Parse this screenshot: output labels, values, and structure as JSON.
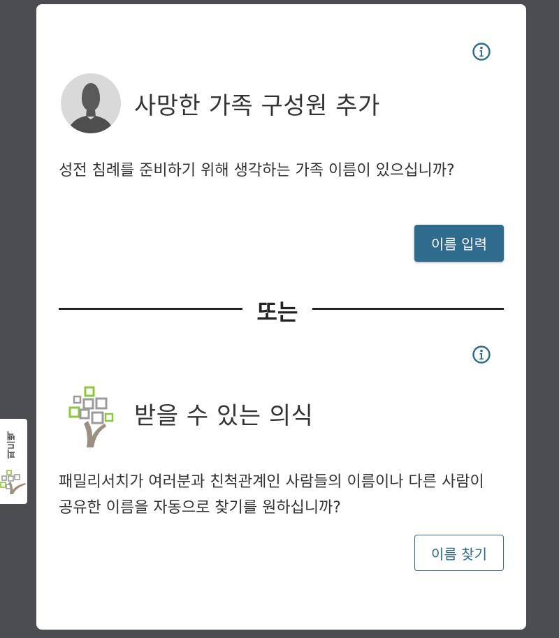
{
  "section_add": {
    "title": "사망한 가족 구성원 추가",
    "description": "성전 침례를 준비하기 위해 생각하는 가족 이름이 있으십니까?",
    "button_label": "이름 입력",
    "info_icon": "info-icon",
    "avatar_icon": "person-silhouette-icon"
  },
  "divider": {
    "label": "또는"
  },
  "section_ordinances": {
    "title": "받을 수 있는 의식",
    "description": "패밀리서치가 여러분과 친척관계인 사람들의 이름이나 다른 사람이 공유한 이름을 자동으로 찾기를 원하십니까?",
    "button_label": "이름 찾기",
    "info_icon": "info-icon",
    "logo_icon": "family-tree-icon"
  },
  "side_tab": {
    "label": "피드백",
    "icon": "family-tree-icon"
  },
  "colors": {
    "background": "#4b4d50",
    "card": "#ffffff",
    "primary": "#2f6b8c",
    "text": "#333333",
    "tree_green": "#8dc63f",
    "tree_gray": "#9b9b9b",
    "tree_trunk": "#9a8f80"
  }
}
